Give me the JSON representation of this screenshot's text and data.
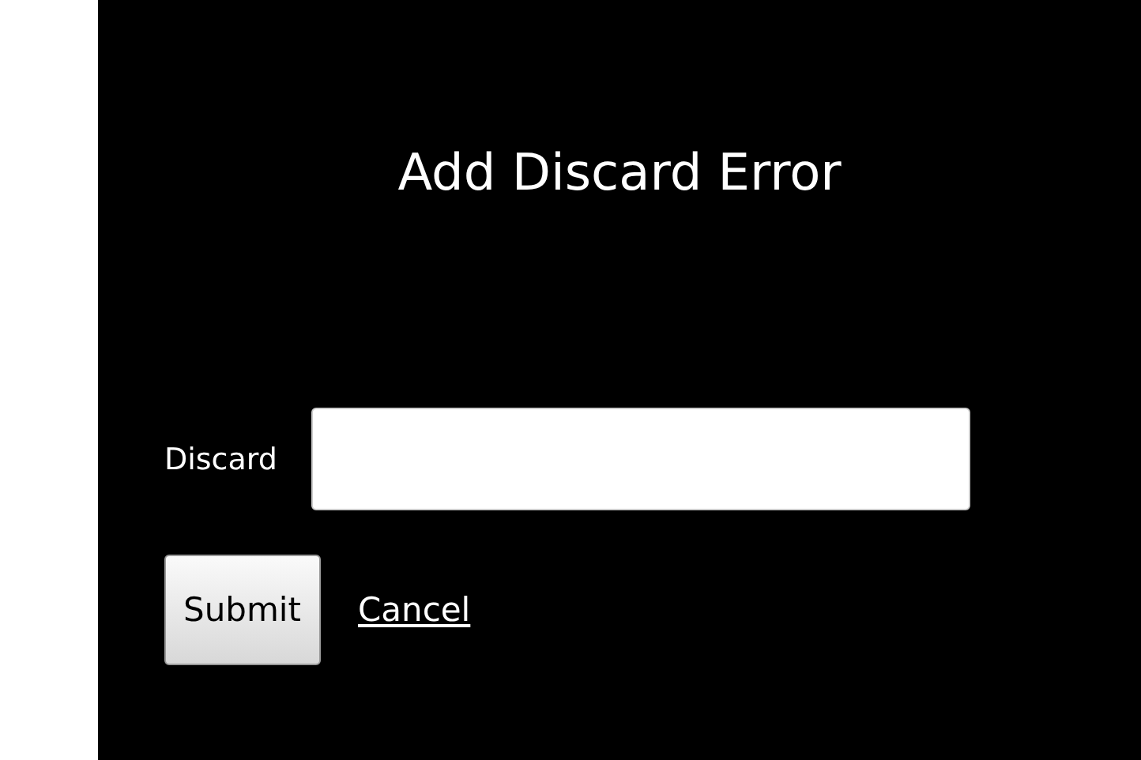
{
  "title": "Add Discard Error",
  "field": {
    "label": "Discard"
  },
  "buttons": [
    {
      "kind": "button",
      "label": "Submit"
    },
    {
      "kind": "link",
      "label": "Cancel"
    }
  ]
}
